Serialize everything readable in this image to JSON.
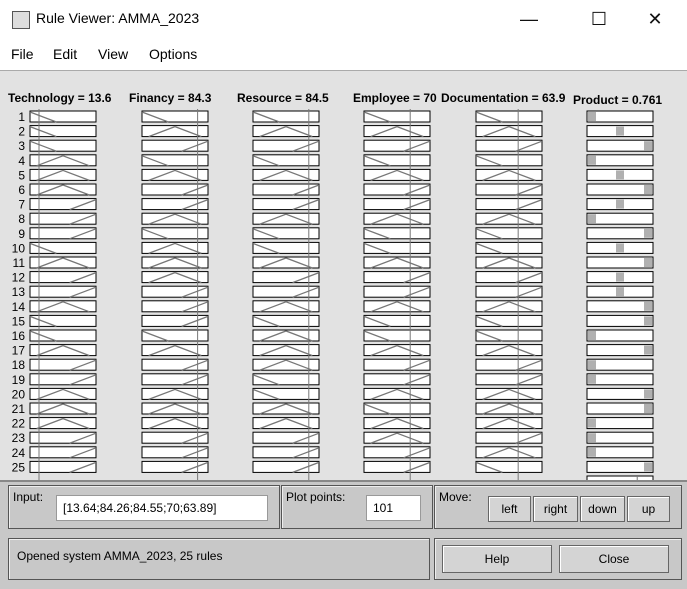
{
  "window": {
    "title": "Rule Viewer: AMMA_2023",
    "minimize": "—",
    "maximize": "☐",
    "close": "✕"
  },
  "menu": [
    "File",
    "Edit",
    "View",
    "Options"
  ],
  "variables": [
    {
      "label": "Technology = 13.6",
      "value": 13.64
    },
    {
      "label": "Financy = 84.3",
      "value": 84.26
    },
    {
      "label": "Resource = 84.5",
      "value": 84.55
    },
    {
      "label": "Employee = 70",
      "value": 70
    },
    {
      "label": "Documentation = 63.9",
      "value": 63.89
    },
    {
      "label": "Product = 0.761",
      "value": 0.761
    }
  ],
  "rules": {
    "numbers": [
      "1",
      "2",
      "3",
      "4",
      "5",
      "6",
      "7",
      "8",
      "9",
      "10",
      "11",
      "12",
      "13",
      "14",
      "15",
      "16",
      "17",
      "18",
      "19",
      "20",
      "21",
      "22",
      "23",
      "24",
      "25"
    ],
    "technology": "LLLMMMHHHLMHHMLLMHHMMMHHH",
    "financy": "LMHLMHHMLMMMHHHLMHHMMMHHH",
    "resource": "LMHLMHHMLLMHHMLMMMLLMMHHH",
    "employee": "LMHLMHHMLLMHHMLLMHHMLMMHH",
    "documentation": "LMHLMHHMLLMHHMLLMHHMMMHML",
    "product": "LMHLMHMLHMHMMHHLHLLHHLLLH"
  },
  "bottom": {
    "input_label": "Input:",
    "input_value": "[13.64;84.26;84.55;70;63.89]",
    "plot_points_label": "Plot points:",
    "plot_points_value": "101",
    "move_label": "Move:",
    "left": "left",
    "right": "right",
    "down": "down",
    "up": "up",
    "status": "Opened system AMMA_2023, 25 rules",
    "help": "Help",
    "close": "Close"
  },
  "colors": {
    "background": "#e2e2e2",
    "mf_line": "#777777",
    "fired": "#b0b0b0",
    "panel": "#c8c8c8"
  }
}
